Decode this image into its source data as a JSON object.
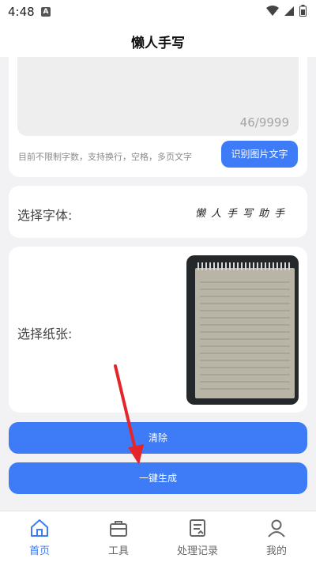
{
  "status_bar": {
    "time": "4:48",
    "app_icon": "A"
  },
  "header": {
    "title": "懒人手写"
  },
  "text_input": {
    "counter": "46/9999",
    "hint": "目前不限制字数，支持换行，空格，多页文字",
    "ocr_button": "识别图片文字"
  },
  "font": {
    "label": "选择字体:",
    "preview": "懒人手写助手"
  },
  "paper": {
    "label": "选择纸张:"
  },
  "buttons": {
    "clear": "清除",
    "generate": "一键生成"
  },
  "nav": {
    "items": [
      {
        "label": "首页",
        "icon": "home-icon",
        "active": true
      },
      {
        "label": "工具",
        "icon": "toolbox-icon",
        "active": false
      },
      {
        "label": "处理记录",
        "icon": "document-icon",
        "active": false
      },
      {
        "label": "我的",
        "icon": "user-icon",
        "active": false
      }
    ]
  },
  "colors": {
    "accent": "#3e7cf7",
    "annotation_arrow": "#e3262b"
  }
}
